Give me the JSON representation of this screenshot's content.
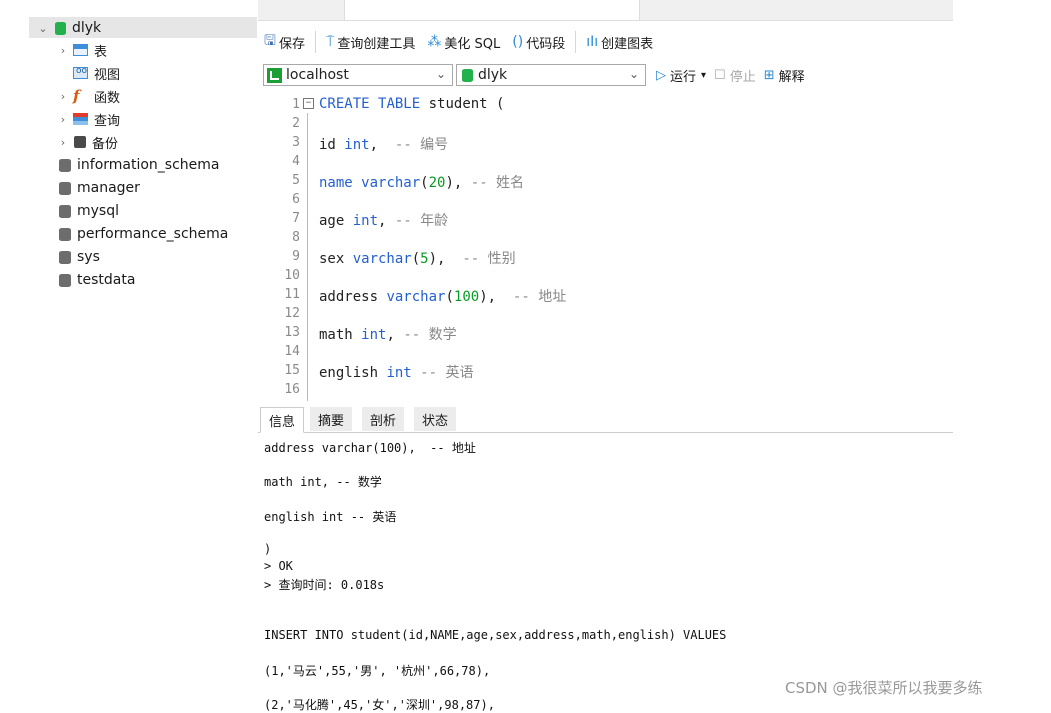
{
  "sidebar": {
    "root": {
      "label": "dlyk"
    },
    "children": [
      {
        "label": "表"
      },
      {
        "label": "视图"
      },
      {
        "label": "函数"
      },
      {
        "label": "查询"
      },
      {
        "label": "备份"
      }
    ],
    "databases": [
      {
        "label": "information_schema"
      },
      {
        "label": "manager"
      },
      {
        "label": "mysql"
      },
      {
        "label": "performance_schema"
      },
      {
        "label": "sys"
      },
      {
        "label": "testdata"
      }
    ]
  },
  "toolbar": {
    "save": "保存",
    "query_builder": "查询创建工具",
    "beautify": "美化 SQL",
    "snippet": "代码段",
    "create_chart": "创建图表"
  },
  "connbar": {
    "connection": "localhost",
    "database": "dlyk",
    "run": "运行",
    "stop": "停止",
    "explain": "解释"
  },
  "editor": {
    "line_numbers": [
      "1",
      "2",
      "3",
      "4",
      "5",
      "6",
      "7",
      "8",
      "9",
      "10",
      "11",
      "12",
      "13",
      "14",
      "15",
      "16"
    ],
    "lines": {
      "l1": {
        "kw1": "CREATE",
        "kw2": "TABLE",
        "rest": " student ("
      },
      "l3": {
        "name": "id ",
        "type": "int",
        "rest": ",  ",
        "comment": "-- 编号"
      },
      "l5": {
        "name": "name ",
        "type": "varchar",
        "open": "(",
        "num": "20",
        "close": "), ",
        "comment": "-- 姓名"
      },
      "l7": {
        "name": "age ",
        "type": "int",
        "rest": ", ",
        "comment": "-- 年龄"
      },
      "l9": {
        "name": "sex ",
        "type": "varchar",
        "open": "(",
        "num": "5",
        "close": "),  ",
        "comment": "-- 性别"
      },
      "l11": {
        "name": "address ",
        "type": "varchar",
        "open": "(",
        "num": "100",
        "close": "),  ",
        "comment": "-- 地址"
      },
      "l13": {
        "name": "math ",
        "type": "int",
        "rest": ", ",
        "comment": "-- 数学"
      },
      "l15": {
        "name": "english ",
        "type": "int",
        "rest": " ",
        "comment": "-- 英语"
      }
    }
  },
  "result": {
    "tabs": [
      "信息",
      "摘要",
      "剖析",
      "状态"
    ],
    "log": [
      "address varchar(100),  -- 地址",
      "math int, -- 数学",
      "english int -- 英语",
      ")",
      "> OK",
      "> 查询时间: 0.018s",
      "INSERT INTO student(id,NAME,age,sex,address,math,english) VALUES",
      "(1,'马云',55,'男', '杭州',66,78),",
      "(2,'马化腾',45,'女','深圳',98,87),"
    ]
  },
  "watermark": "CSDN @我很菜所以我要多练"
}
